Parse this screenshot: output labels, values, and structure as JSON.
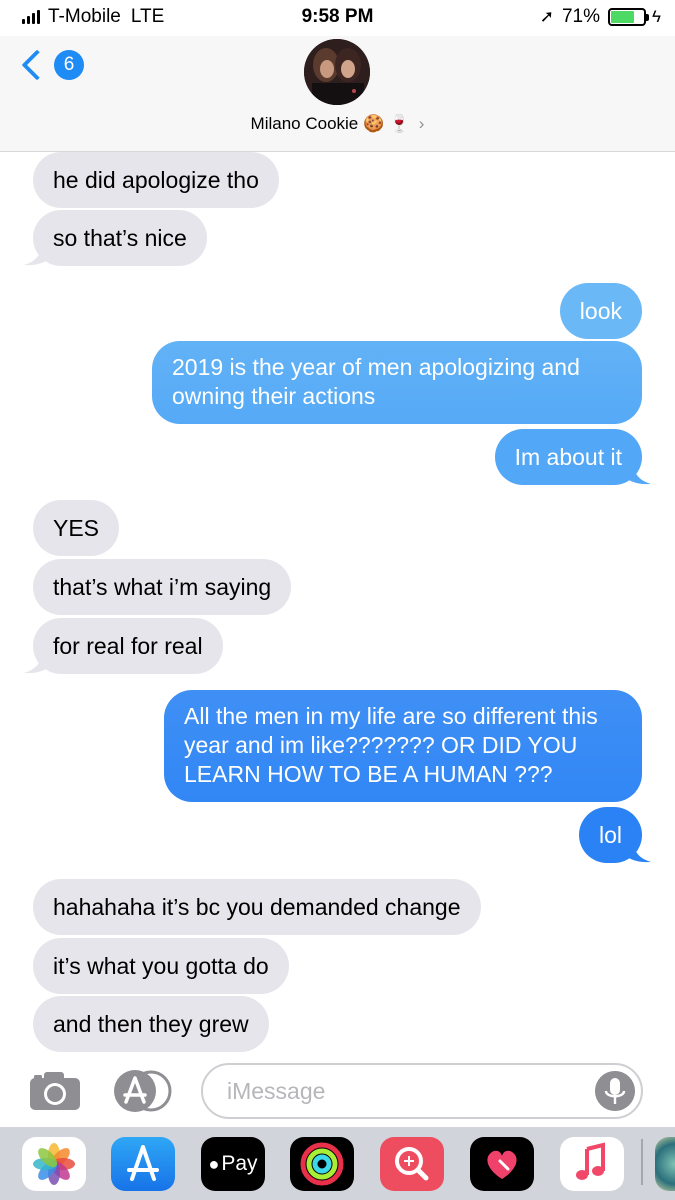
{
  "status_bar": {
    "carrier": "T-Mobile",
    "network": "LTE",
    "time": "9:58 PM",
    "battery": "71%",
    "battery_level": 0.71
  },
  "header": {
    "back_count": "6",
    "contact_name": "Milano Cookie 🍪 🍷",
    "chevron": "›"
  },
  "messages": [
    {
      "direction": "incoming",
      "text": "he did apologize tho"
    },
    {
      "direction": "incoming",
      "text": "so that’s nice"
    },
    {
      "direction": "outgoing",
      "text": "look"
    },
    {
      "direction": "outgoing",
      "text": "2019 is the year of men apologizing and owning their actions"
    },
    {
      "direction": "outgoing",
      "text": "Im about it"
    },
    {
      "direction": "incoming",
      "text": "YES"
    },
    {
      "direction": "incoming",
      "text": "that’s what i’m saying"
    },
    {
      "direction": "incoming",
      "text": "for real for real"
    },
    {
      "direction": "outgoing",
      "text": "All the men in my life are so different this year and im like??????? OR DID YOU LEARN HOW TO BE A HUMAN ???"
    },
    {
      "direction": "outgoing",
      "text": "lol"
    },
    {
      "direction": "incoming",
      "text": "hahahaha it’s bc you demanded change"
    },
    {
      "direction": "incoming",
      "text": "it’s what you gotta do"
    },
    {
      "direction": "incoming",
      "text": "and then they grew"
    }
  ],
  "input": {
    "placeholder": "iMessage"
  },
  "app_drawer": {
    "apple_pay_label": "Pay",
    "apps": [
      "photos-icon",
      "app-store-icon",
      "apple-pay-icon",
      "activity-icon",
      "search-images-icon",
      "digital-touch-icon",
      "music-icon",
      "more-apps-icon"
    ]
  },
  "colors": {
    "accent": "#1f8bf5",
    "incoming_bubble": "#e6e5eb",
    "outgoing_top": "#6bb8f6",
    "outgoing_bottom": "#1f84f5",
    "drawer": "#d1d4da"
  }
}
